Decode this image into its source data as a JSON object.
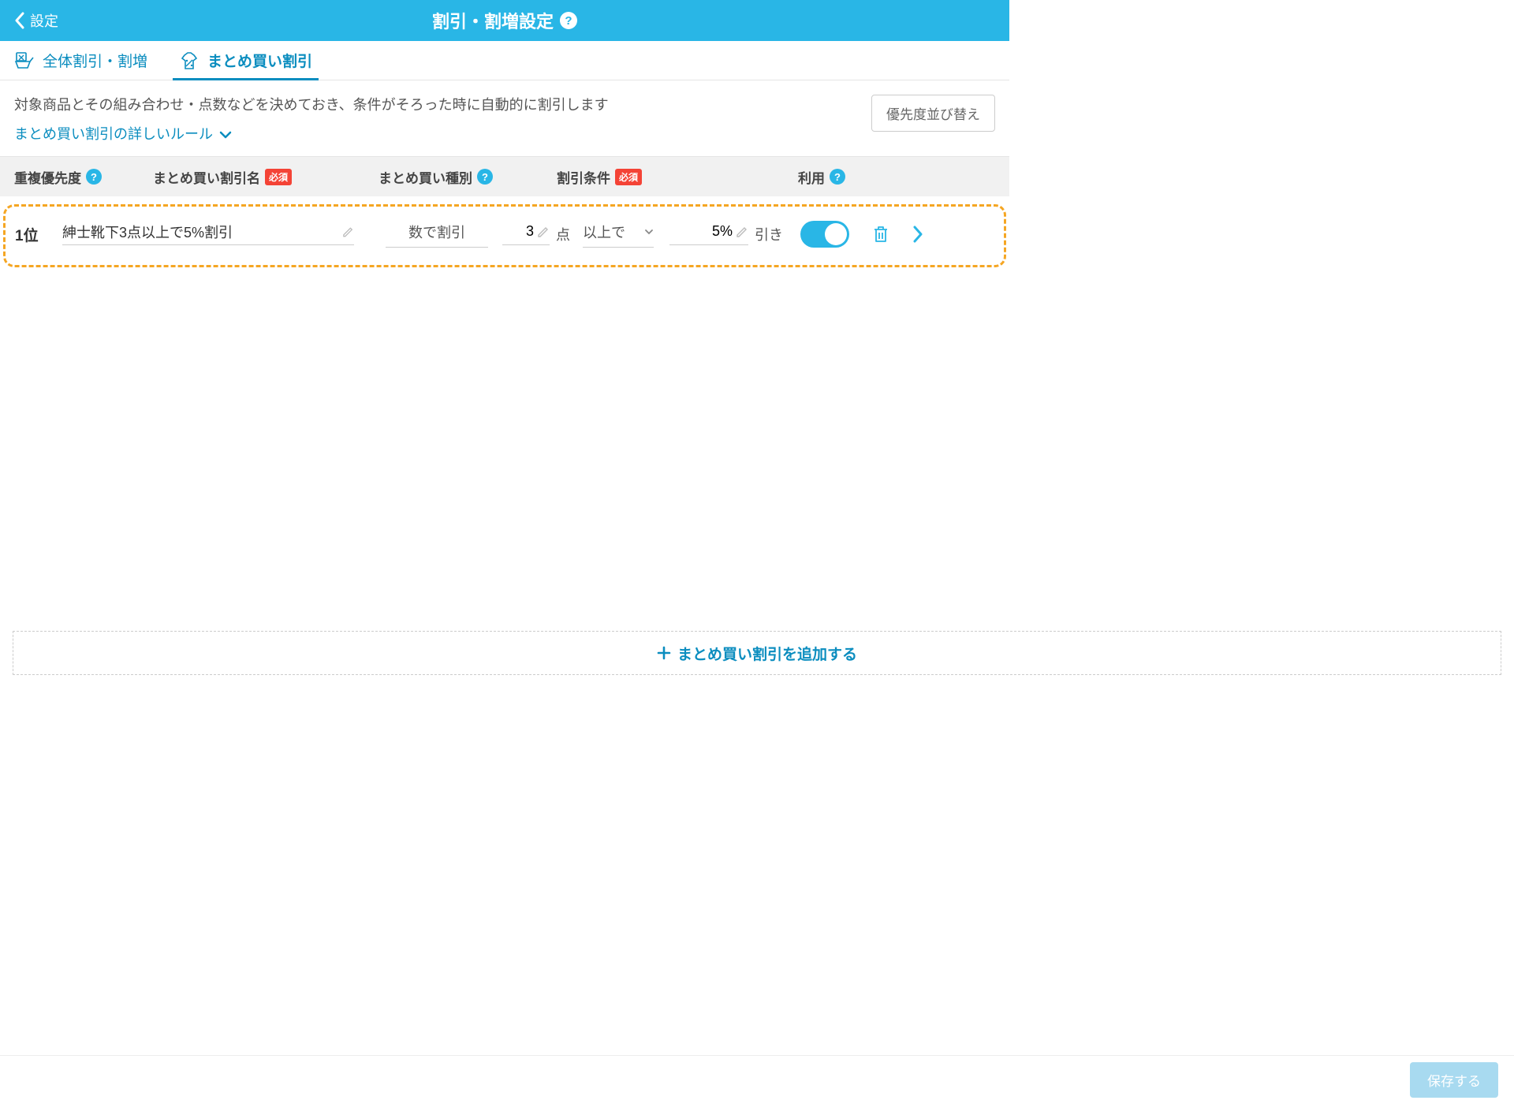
{
  "header": {
    "back_label": "設定",
    "title": "割引・割増設定",
    "help_glyph": "?"
  },
  "tabs": {
    "overall": "全体割引・割増",
    "bulk": "まとめ買い割引"
  },
  "desc": {
    "text": "対象商品とその組み合わせ・点数などを決めておき、条件がそろった時に自動的に割引します",
    "rule_link": "まとめ買い割引の詳しいルール",
    "sort_button": "優先度並び替え"
  },
  "columns": {
    "priority": "重複優先度",
    "name": "まとめ買い割引名",
    "kind": "まとめ買い種別",
    "condition": "割引条件",
    "use": "利用",
    "required_badge": "必須"
  },
  "row": {
    "rank": "1位",
    "name_value": "紳士靴下3点以上で5%割引",
    "kind_value": "数で割引",
    "qty_value": "3",
    "qty_unit": "点",
    "cond_select": "以上で",
    "pct_value": "5%",
    "pct_suffix": "引き",
    "toggle_on": true
  },
  "add_button": "まとめ買い割引を追加する",
  "footer": {
    "save": "保存する"
  }
}
